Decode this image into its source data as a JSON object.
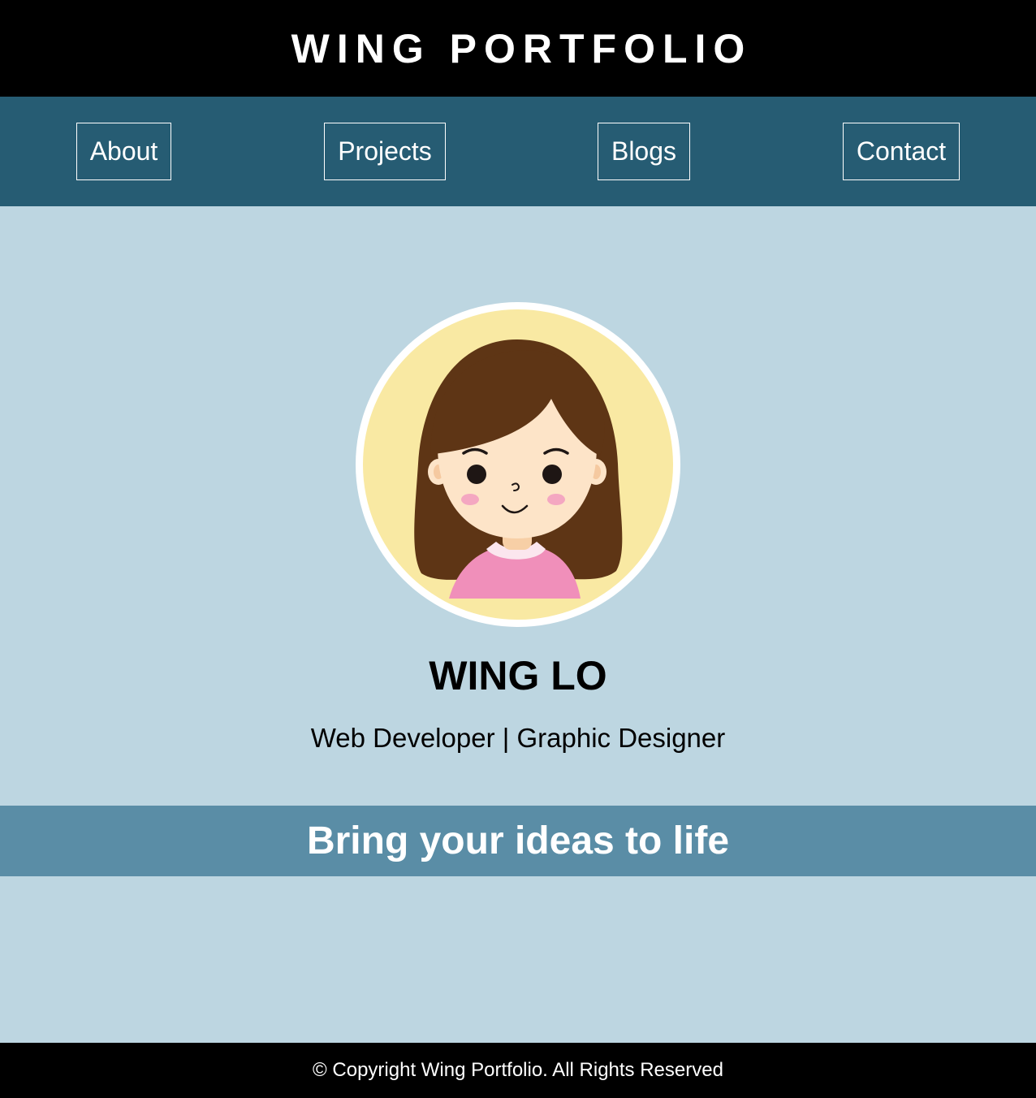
{
  "header": {
    "title": "WING PORTFOLIO"
  },
  "nav": {
    "items": [
      {
        "label": "About"
      },
      {
        "label": "Projects"
      },
      {
        "label": "Blogs"
      },
      {
        "label": "Contact"
      }
    ]
  },
  "profile": {
    "avatar_icon": "girl-avatar-illustration",
    "name": "WING LO",
    "role": "Web Developer | Graphic Designer"
  },
  "banner": {
    "text": "Bring your ideas to life"
  },
  "footer": {
    "text": "© Copyright Wing Portfolio. All Rights Reserved"
  },
  "colors": {
    "header_bg": "#000000",
    "nav_bg": "#265c73",
    "page_bg": "#bdd6e1",
    "banner_bg": "#5a8da6",
    "footer_bg": "#000000",
    "avatar_bg": "#f9e9a3",
    "hair": "#5e3515",
    "skin": "#fde4c8",
    "shirt": "#f08fba"
  }
}
